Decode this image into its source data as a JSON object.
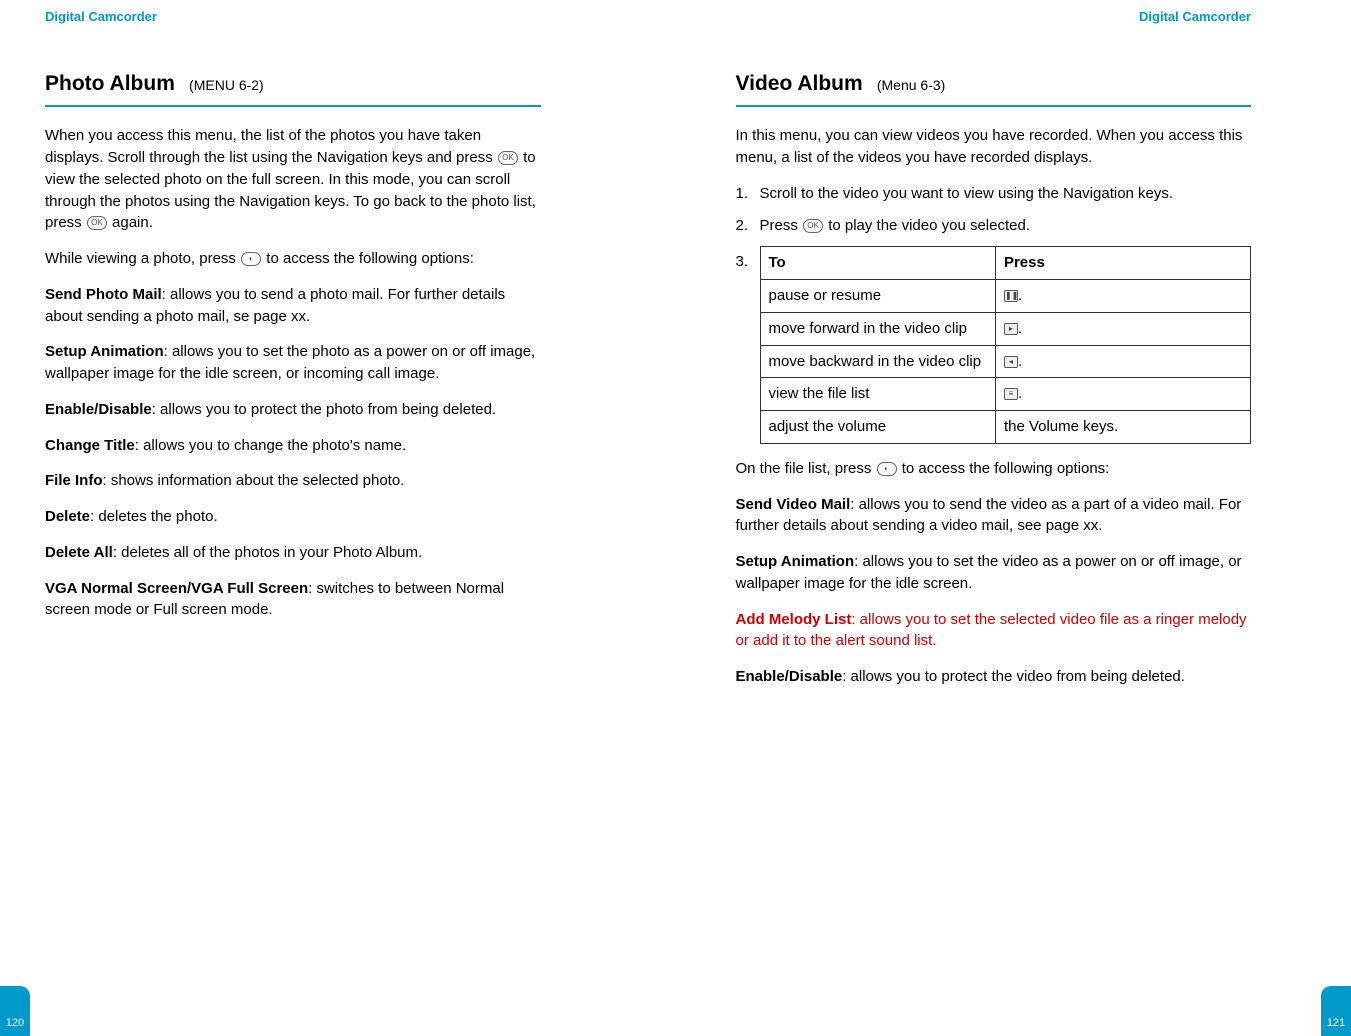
{
  "left": {
    "header": "Digital Camcorder",
    "title": "Photo Album",
    "subtitle": "(MENU 6-2)",
    "intro1a": "When you access this menu, the list of the photos you have taken displays. Scroll through the list using the Navigation keys and press ",
    "intro1b": " to view the selected photo on the full screen. In this mode, you can scroll through the photos using the Navigation keys. To go back to the photo list, press ",
    "intro1c": " again.",
    "intro2a": "While viewing a photo, press ",
    "intro2b": " to access the following options:",
    "opts": [
      {
        "t": "Send Photo Mail",
        "d": ": allows you to send a photo mail. For further details about sending a photo mail, se page xx."
      },
      {
        "t": "Setup Animation",
        "d": ": allows you to set the photo as a power on or off image, wallpaper image for the idle screen, or incoming call image."
      },
      {
        "t": "Enable/Disable",
        "d": ": allows you to protect the photo from being deleted."
      },
      {
        "t": "Change Title",
        "d": ": allows you to change the photo's name."
      },
      {
        "t": "File Info",
        "d": ": shows information about the selected photo."
      },
      {
        "t": "Delete",
        "d": ": deletes the photo."
      },
      {
        "t": "Delete All",
        "d": ": deletes all of the photos in your Photo Album."
      },
      {
        "t": "VGA Normal Screen/VGA Full Screen",
        "d": ": switches to between Normal screen mode or Full screen mode."
      }
    ],
    "pagenum": "120"
  },
  "right": {
    "header": "Digital Camcorder",
    "title": "Video Album",
    "subtitle": "(Menu 6-3)",
    "intro1": "In this menu, you can view videos you have recorded. When you access this menu, a list of the videos you have recorded displays.",
    "step1num": "1.",
    "step1": "Scroll to the video you want to view using the Navigation keys.",
    "step2num": "2.",
    "step2a": "Press ",
    "step2b": " to play the video you selected.",
    "step3num": "3.",
    "th1": "To",
    "th2": "Press",
    "rows": [
      {
        "to": "pause or resume",
        "press_icon": "p",
        "press_after": "."
      },
      {
        "to": "move forward in the video clip",
        "press_icon": "f",
        "press_after": "."
      },
      {
        "to": "move backward in the video clip",
        "press_icon": "b",
        "press_after": "."
      },
      {
        "to": "view the file list",
        "press_icon": "l",
        "press_after": "."
      },
      {
        "to": "adjust the volume",
        "press_text": "the Volume keys."
      }
    ],
    "after_table_a": "On the file list, press ",
    "after_table_b": " to access the following options:",
    "opts": [
      {
        "t": "Send Video Mail",
        "d": ": allows you to send the video as a part of a video mail. For further details about sending a video mail, see page xx."
      },
      {
        "t": "Setup Animation",
        "d": ": allows you to set the video as a power on or off image, or wallpaper image for the idle screen."
      },
      {
        "t": "Add Melody List",
        "d": ": allows you to set the selected video file as a ringer melody or add it to the alert sound list.",
        "red": true
      },
      {
        "t": "Enable/Disable",
        "d": ": allows you to protect the video from being deleted."
      }
    ],
    "pagenum": "121"
  }
}
